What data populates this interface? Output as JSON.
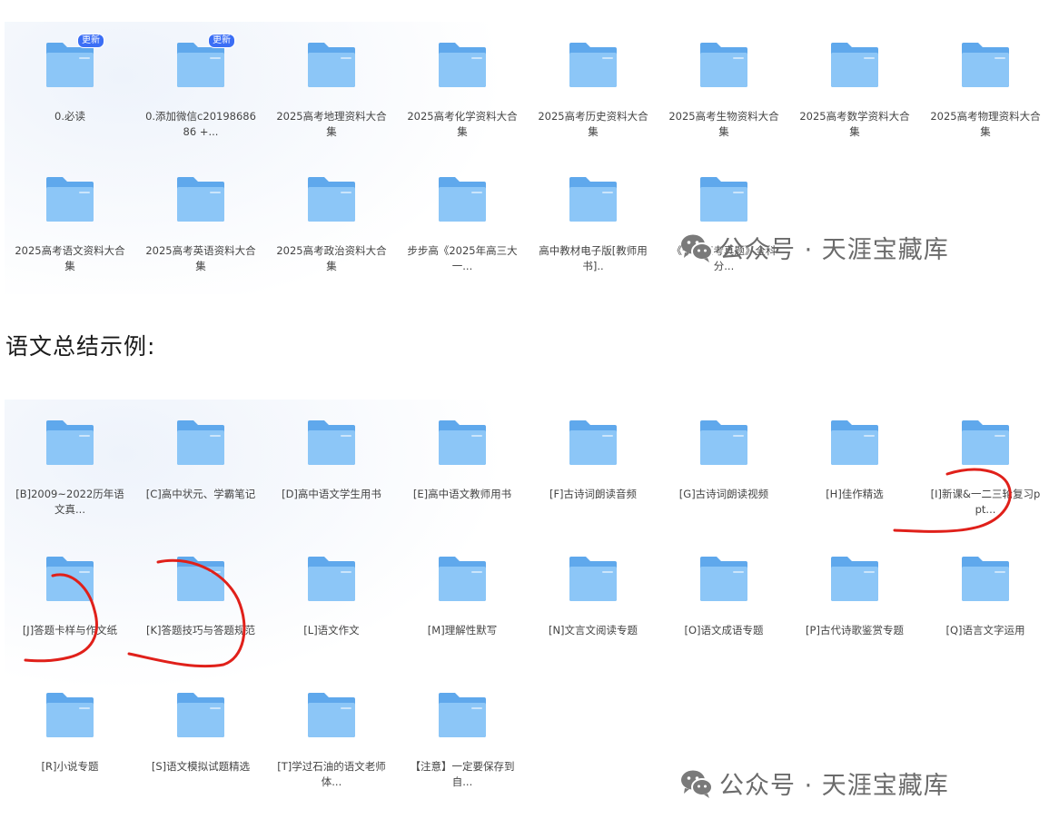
{
  "top_grid": {
    "folders": [
      {
        "label": "0.必读",
        "badge": "更新"
      },
      {
        "label": "0.添加微信c2019868686 +...",
        "badge": "更新"
      },
      {
        "label": "2025高考地理资料大合集",
        "badge": ""
      },
      {
        "label": "2025高考化学资料大合集",
        "badge": ""
      },
      {
        "label": "2025高考历史资料大合集",
        "badge": ""
      },
      {
        "label": "2025高考生物资料大合集",
        "badge": ""
      },
      {
        "label": "2025高考数学资料大合集",
        "badge": ""
      },
      {
        "label": "2025高考物理资料大合集",
        "badge": ""
      },
      {
        "label": "2025高考语文资料大合集",
        "badge": ""
      },
      {
        "label": "2025高考英语资料大合集",
        "badge": ""
      },
      {
        "label": "2025高考政治资料大合集",
        "badge": ""
      },
      {
        "label": "步步高《2025年高三大一...",
        "badge": ""
      },
      {
        "label": "高中教材电子版[教师用书]..",
        "badge": ""
      },
      {
        "label": "《十年高考真题》全科分...",
        "badge": ""
      }
    ]
  },
  "section_heading": "语文总结示例:",
  "bottom_grid": {
    "folders": [
      {
        "label": "[B]2009~2022历年语文真..."
      },
      {
        "label": "[C]高中状元、学霸笔记"
      },
      {
        "label": "[D]高中语文学生用书"
      },
      {
        "label": "[E]高中语文教师用书"
      },
      {
        "label": "[F]古诗词朗读音频"
      },
      {
        "label": "[G]古诗词朗读视频"
      },
      {
        "label": "[H]佳作精选"
      },
      {
        "label": "[I]新课&一二三轮复习ppt..."
      },
      {
        "label": "[J]答题卡样与作文纸"
      },
      {
        "label": "[K]答题技巧与答题规范"
      },
      {
        "label": "[L]语文作文"
      },
      {
        "label": "[M]理解性默写"
      },
      {
        "label": "[N]文言文阅读专题"
      },
      {
        "label": "[O]语文成语专题"
      },
      {
        "label": "[P]古代诗歌鉴赏专题"
      },
      {
        "label": "[Q]语言文字运用"
      },
      {
        "label": "[R]小说专题"
      },
      {
        "label": "[S]语文模拟试题精选"
      },
      {
        "label": "[T]学过石油的语文老师体..."
      },
      {
        "label": "【注意】一定要保存到自..."
      }
    ]
  },
  "watermark": {
    "text": "公众号 · 天涯宝藏库",
    "icon": "wechat-icon"
  },
  "colors": {
    "folder_back": "#5fa8ec",
    "folder_front": "#8cc6f7",
    "badge": "#3b6ef5",
    "annotation": "#e0201a"
  }
}
